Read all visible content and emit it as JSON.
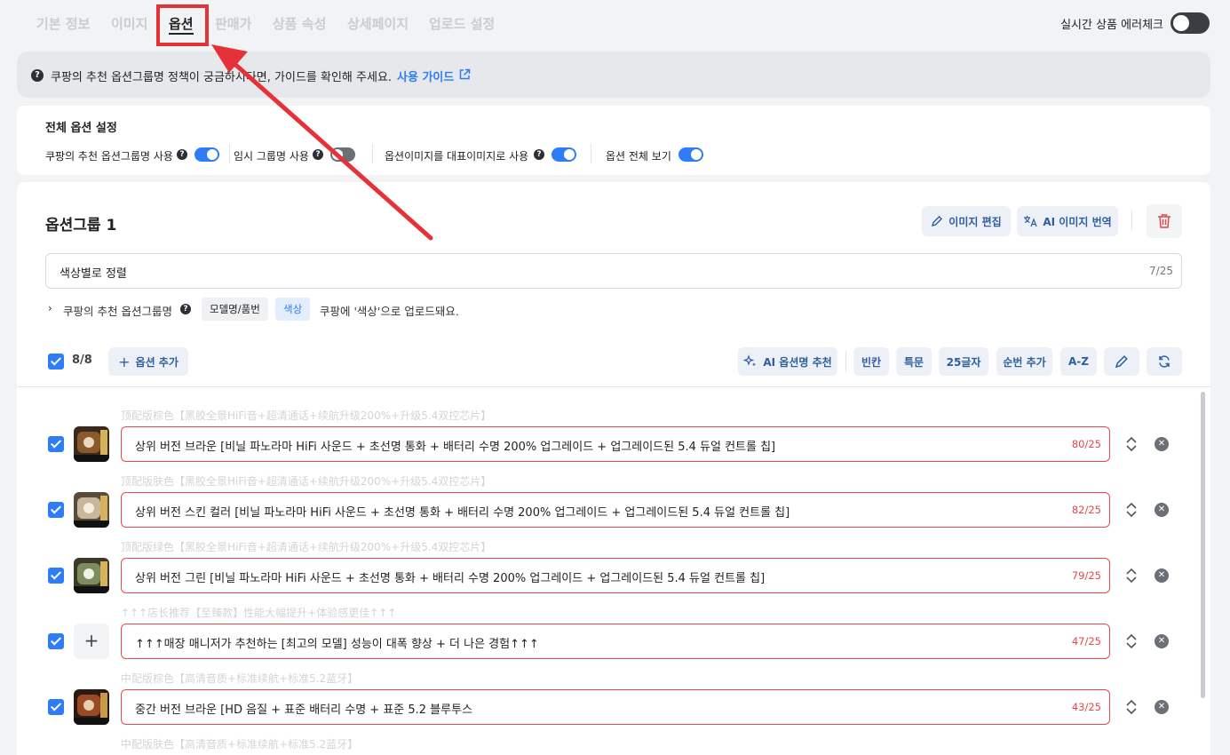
{
  "tabs": [
    {
      "label": "기본 정보"
    },
    {
      "label": "이미지"
    },
    {
      "label": "옵션"
    },
    {
      "label": "판매가"
    },
    {
      "label": "상품 속성"
    },
    {
      "label": "상세페이지"
    },
    {
      "label": "업로드 설정"
    }
  ],
  "active_tab": "옵션",
  "realtime_check": {
    "label": "실시간 상품 에러체크",
    "enabled": false
  },
  "banner": {
    "text": "쿠팡의 추천 옵션그룹명 정책이 궁금하시다면, 가이드를 확인해 주세요.",
    "link": "사용 가이드"
  },
  "settings": {
    "title": "전체 옵션 설정",
    "items": [
      {
        "label": "쿠팡의 추천 옵션그룹명 사용",
        "enabled": true
      },
      {
        "label": "임시 그룹명 사용",
        "enabled": false
      },
      {
        "label": "옵션이미지를 대표이미지로 사용",
        "enabled": true
      },
      {
        "label": "옵션 전체 보기",
        "enabled": true
      }
    ]
  },
  "group": {
    "title": "옵션그룹 1",
    "edit_image": "이미지 편집",
    "ai_translate": "AI 이미지 번역",
    "name_value": "색상별로 정렬",
    "name_count": "7/25",
    "recommend_label": "쿠팡의 추천 옵션그룹명",
    "chip_model": "모델명/품번",
    "chip_color": "색상",
    "recommend_note": "쿠팡에 '색상'으로 업로드돼요."
  },
  "toolbar": {
    "count": "8/8",
    "add_option": "옵션 추가",
    "ai_recommend": "AI 옵션명 추천",
    "blank": "빈칸",
    "special": "특문",
    "chars25": "25글자",
    "add_order": "순번 추가",
    "az": "A-Z"
  },
  "options": [
    {
      "hint": "顶配版棕色【黑胶全景HiFi音+超清通话+续航升级200%+升级5.4双控芯片】",
      "value": "상위 버전 브라운 [비닐 파노라마 HiFi 사운드 + 초선명 통화 + 배터리 수명 200% 업그레이드 + 업그레이드된 5.4 듀얼 컨트롤 칩]",
      "count": "80/25",
      "thumb_color": "#8a5a2b"
    },
    {
      "hint": "顶配版肤色【黑胶全景HiFi音+超清通话+续航升级200%+升级5.4双控芯片】",
      "value": "상위 버전 스킨 컬러 [비닐 파노라마 HiFi 사운드 + 초선명 통화 + 배터리 수명 200% 업그레이드 + 업그레이드된 5.4 듀얼 컨트롤 칩]",
      "count": "82/25",
      "thumb_color": "#c8b79a"
    },
    {
      "hint": "顶配版绿色【黑胶全景HiFi音+超清通话+续航升级200%+升级5.4双控芯片】",
      "value": "상위 버전 그린 [비닐 파노라마 HiFi 사운드 + 초선명 통화 + 배터리 수명 200% 업그레이드 + 업그레이드된 5.4 듀얼 컨트롤 칩]",
      "count": "79/25",
      "thumb_color": "#7d8c5c"
    },
    {
      "hint": "↑↑↑店长推荐【至臻款】性能大幅提升+体验感更佳↑↑↑",
      "value": "↑↑↑매장 매니저가 추천하는 [최고의 모델] 성능이 대폭 향상 + 더 나은 경험↑↑↑",
      "count": "47/25",
      "thumb_color": ""
    },
    {
      "hint": "中配版棕色【高清音质+标准续航+标准5.2蓝牙】",
      "value": "중간 버전 브라운 [HD 음질 + 표준 배터리 수명 + 표준 5.2 블루투스",
      "count": "43/25",
      "thumb_color": "#9a4a25"
    },
    {
      "hint": "中配版肤色【高清音质+标准续航+标准5.2蓝牙】",
      "value": "",
      "count": "",
      "thumb_color": ""
    }
  ]
}
